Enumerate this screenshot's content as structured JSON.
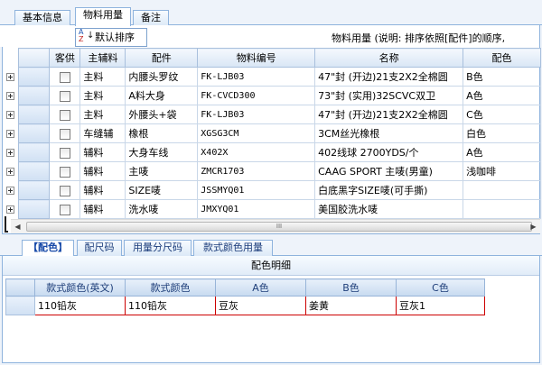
{
  "tabs": [
    "基本信息",
    "物料用量",
    "备注"
  ],
  "toolbar": {
    "sort_label": "默认排序",
    "sort_icon_top": "A",
    "sort_icon_bottom": "Z"
  },
  "hint": "物料用量  (说明: 排序依照[配件]的顺序,",
  "grid": {
    "columns": [
      "客供",
      "主辅料",
      "配件",
      "物料编号",
      "名称",
      "配色"
    ],
    "rows": [
      {
        "main": "主料",
        "part": "内腰头罗纹",
        "code": "FK-LJB03",
        "name": "47\"封 (开边)21支2X2全棉圆",
        "color": "B色"
      },
      {
        "main": "主料",
        "part": "A料大身",
        "code": "FK-CVCD300",
        "name": "73\"封 (实用)32SCVC双卫",
        "color": "A色"
      },
      {
        "main": "主料",
        "part": "外腰头+袋",
        "code": "FK-LJB03",
        "name": "47\"封 (开边)21支2X2全棉圆",
        "color": "C色"
      },
      {
        "main": "车缝辅",
        "part": "橡根",
        "code": "XGSG3CM",
        "name": "3CM丝光橡根",
        "color": "白色"
      },
      {
        "main": "辅料",
        "part": "大身车线",
        "code": "X402X",
        "name": "402线球 2700YDS/个",
        "color": "A色"
      },
      {
        "main": "辅料",
        "part": "主唛",
        "code": "ZMCR1703",
        "name": "CAAG SPORT 主唛(男童)",
        "color": "浅咖啡"
      },
      {
        "main": "辅料",
        "part": "SIZE唛",
        "code": "JSSMYQ01",
        "name": "白底黑字SIZE唛(可手撕)",
        "color": ""
      },
      {
        "main": "辅料",
        "part": "洗水唛",
        "code": "JMXYQ01",
        "name": "美国胶洗水唛",
        "color": ""
      }
    ]
  },
  "scroll": {
    "grip": "III"
  },
  "subtabs": [
    "【配色】",
    "配尺码",
    "用量分尺码",
    "款式颜色用量"
  ],
  "detail": {
    "title": "配色明细",
    "columns": [
      "款式颜色(英文)",
      "款式颜色",
      "A色",
      "B色",
      "C色"
    ],
    "rows": [
      {
        "en": "110铅灰",
        "cn": "110铅灰",
        "a": "豆灰",
        "b": "姜黄",
        "c": "豆灰1"
      }
    ]
  }
}
